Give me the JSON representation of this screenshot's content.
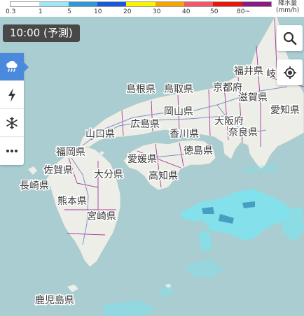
{
  "legend": {
    "colors": [
      "#ffffff",
      "#a0e6f6",
      "#2f98d6",
      "#1a59d8",
      "#f7f500",
      "#f5a400",
      "#f25868",
      "#e8180c",
      "#8c1a86"
    ],
    "ticks": [
      "0.3",
      "1",
      "5",
      "10",
      "20",
      "30",
      "40",
      "50",
      "80~"
    ],
    "unit_line1": "降水量",
    "unit_line2": "(mm/h)"
  },
  "time_badge": "10:00 (予測)",
  "toolbar": {
    "items": [
      {
        "name": "rain",
        "icon": "rain-cloud-icon",
        "active": true
      },
      {
        "name": "lightning",
        "icon": "lightning-icon",
        "active": false
      },
      {
        "name": "snow",
        "icon": "snowflake-icon",
        "active": false
      },
      {
        "name": "more",
        "icon": "more-dots-icon",
        "active": false
      }
    ]
  },
  "buttons": {
    "search": "search-icon",
    "location": "location-target-icon"
  },
  "colors": {
    "sea": "#a9cdd0",
    "land": "#eeeee8",
    "rain_light": "#7fe2ec",
    "rain_mid": "#3d92b8"
  },
  "map_labels": {
    "kyoto": "京都府",
    "shimane": "島根県",
    "tottori": "鳥取県",
    "fukui": "福井県",
    "gifu": "岐",
    "shiga": "滋賀県",
    "aichi": "愛知県",
    "okayama": "岡山県",
    "hiroshima": "広島県",
    "osaka": "大阪府",
    "yamaguchi": "山口県",
    "kagawa": "香川県",
    "nara": "奈良県",
    "fukuoka": "福岡県",
    "tokushima": "徳島県",
    "ehime": "愛媛県",
    "saga": "佐賀県",
    "oita": "大分県",
    "kochi": "高知県",
    "nagasaki": "長崎県",
    "kumamoto": "熊本県",
    "miyazaki": "宮崎県",
    "kagoshima": "鹿児島県"
  }
}
